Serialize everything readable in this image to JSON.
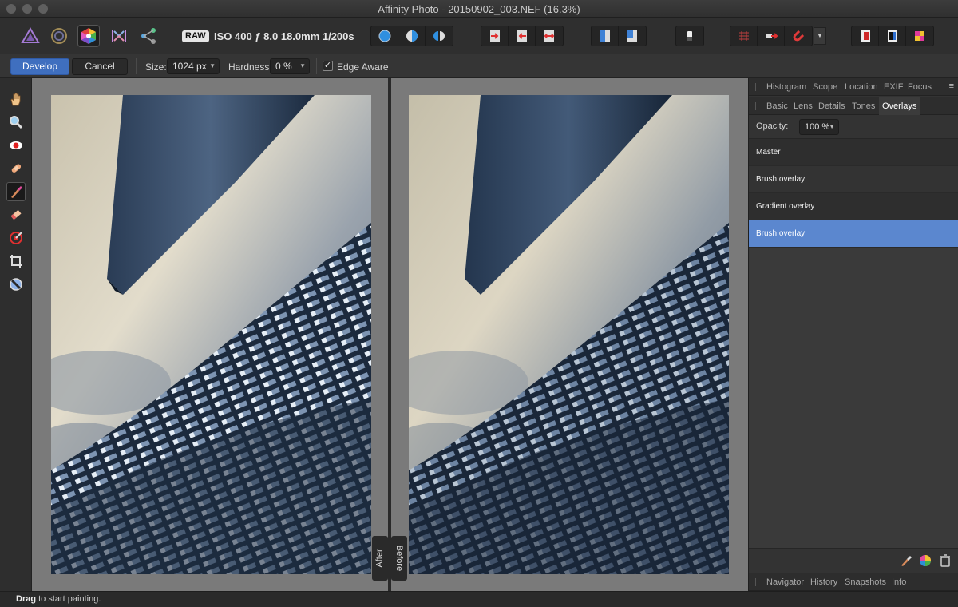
{
  "window": {
    "title": "Affinity Photo - 20150902_003.NEF (16.3%)"
  },
  "toolbar": {
    "personas": [
      "photo-persona-icon",
      "liquify-persona-icon",
      "develop-persona-icon",
      "tone-mapping-persona-icon",
      "export-persona-icon"
    ],
    "raw_badge": "RAW",
    "exif_info": "ISO 400 ƒ 8.0 18.0mm 1/200s"
  },
  "context": {
    "develop_label": "Develop",
    "cancel_label": "Cancel",
    "size_label": "Size:",
    "size_value": "1024 px",
    "hardness_label": "Hardness:",
    "hardness_value": "0 %",
    "edge_aware_label": "Edge Aware",
    "edge_aware_checked": "✓"
  },
  "canvas": {
    "after_label": "After",
    "before_label": "Before"
  },
  "panel": {
    "top_tabs": [
      "Histogram",
      "Scope",
      "Location",
      "EXIF",
      "Focus"
    ],
    "sub_tabs": [
      "Basic",
      "Lens",
      "Details",
      "Tones",
      "Overlays"
    ],
    "active_sub_tab": "Overlays",
    "opacity_label": "Opacity:",
    "opacity_value": "100 %",
    "overlays": [
      "Master",
      "Brush overlay",
      "Gradient overlay",
      "Brush overlay"
    ],
    "selected_overlay_index": 3,
    "bottom_tabs": [
      "Navigator",
      "History",
      "Snapshots",
      "Info"
    ]
  },
  "status": {
    "bold": "Drag",
    "rest": " to start painting."
  },
  "colors": {
    "accent": "#5b87cf",
    "develop_button": "#3f6fbf"
  }
}
